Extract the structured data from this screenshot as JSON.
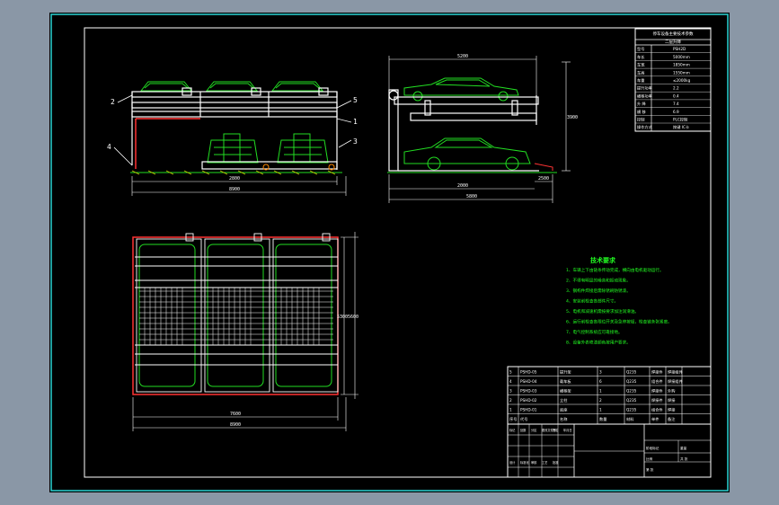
{
  "drawing": {
    "leaders": {
      "left_view": [
        "2",
        "5",
        "1",
        "3",
        "4"
      ]
    },
    "dimensions": {
      "front_span_1": "2800",
      "front_span_2": "8900",
      "side_top": "5200",
      "side_gap": "2000",
      "side_bottom": "2500",
      "side_overall": "5800",
      "side_height": "3900",
      "plan_width_1": "7600",
      "plan_width_2": "8900",
      "plan_depth_1": "5300",
      "plan_depth_2": "5600"
    },
    "tech_requirements": {
      "title": "技术要求",
      "lines": [
        "1、车辆上下由链条传动完成，横向由电机驱动运行。",
        "2、不得有明显的噪音和振动现象。",
        "3、钢构件焊接后需除锈刷防锈漆。",
        "4、安装前检查各部件尺寸。",
        "5、电机和减速机需按要求加注润滑油。",
        "6、运行前检查各限位开关及急停按钮，检查链条张紧度。",
        "7、电气控制系统应可靠接地。",
        "8、设备外表喷漆颜色按用户要求。"
      ]
    },
    "spec_table": {
      "header": "停车设备主要技术参数",
      "subheader": "二层升降",
      "rows": [
        {
          "k": "型号",
          "v": "PSH2D"
        },
        {
          "k": "车长",
          "v": "5000mm"
        },
        {
          "k": "车宽",
          "v": "1850mm"
        },
        {
          "k": "车高",
          "v": "1550mm"
        },
        {
          "k": "车重",
          "v": "≤2000kg"
        },
        {
          "k": "提升功率",
          "v": "2.2"
        },
        {
          "k": "横移功率",
          "v": "0.4"
        },
        {
          "k": "升 降",
          "v": "7.4"
        },
        {
          "k": "横 移",
          "v": "6.9"
        },
        {
          "k": "控制",
          "v": "PLC控制"
        },
        {
          "k": "操作方式",
          "v": "按键 IC卡"
        }
      ]
    },
    "parts_list": {
      "rows": [
        [
          "5",
          "PSHD-05",
          "提升架",
          "3",
          "Q235",
          "焊接件",
          "焊接组件"
        ],
        [
          "4",
          "PSHD-04",
          "载车板",
          "6",
          "Q235",
          "组合件",
          "焊接组件"
        ],
        [
          "3",
          "PSHD-03",
          "横移架",
          "1",
          "Q235",
          "焊接件",
          "外购"
        ],
        [
          "2",
          "PSHD-02",
          "立柱",
          "2",
          "Q235",
          "焊接件",
          "焊接"
        ],
        [
          "1",
          "PSHD-01",
          "底座",
          "1",
          "Q235",
          "组合件",
          "焊接"
        ]
      ],
      "header": [
        "序号",
        "代号",
        "名称",
        "数量",
        "材料",
        "单件",
        "备注"
      ]
    },
    "title_block": {
      "labels": [
        "标记",
        "处数",
        "分区",
        "更改文件号",
        "签名",
        "年月日",
        "设计",
        "标准化",
        "审核",
        "工艺",
        "批准"
      ],
      "right": [
        "阶段标记",
        "重量",
        "比例",
        "共 张",
        "第 张"
      ]
    }
  }
}
